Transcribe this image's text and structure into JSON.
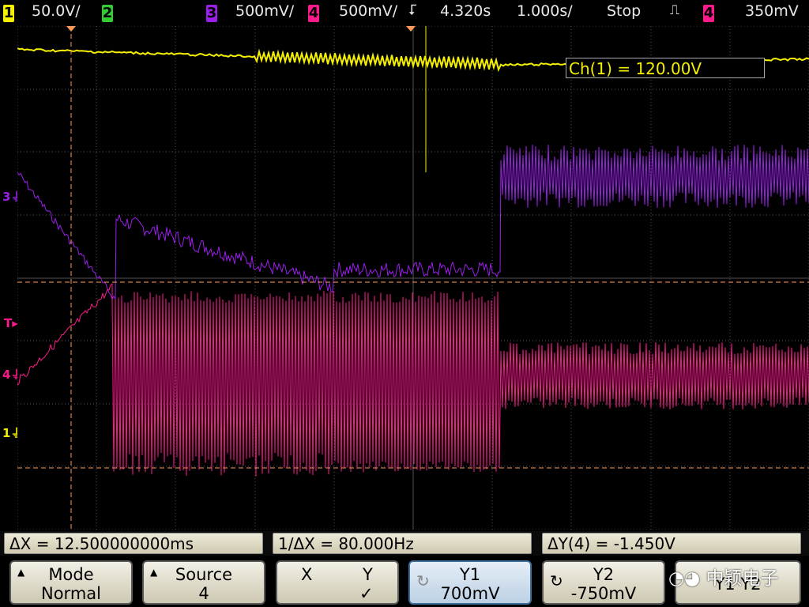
{
  "colors": {
    "ch1": "#f5f000",
    "ch2": "#33cc33",
    "ch3": "#9a1fe8",
    "ch4": "#ff1a8c",
    "grid": "#555555",
    "cursor": "#ff9a5a"
  },
  "topbar": {
    "ch1_num": "1",
    "ch1_scale": "50.0V/",
    "ch2_num": "2",
    "ch3_num": "3",
    "ch3_scale": "500mV/",
    "ch4_num": "4",
    "ch4_scale": "500mV/",
    "trig_delay": "4.320s",
    "timebase": "1.000s/",
    "run_state": "Stop",
    "trig_src": "4",
    "trig_level": "350mV"
  },
  "readout": {
    "ch1": "Ch(1) = 120.00V"
  },
  "markers": {
    "ch3": "3",
    "trig": "T",
    "ch4": "4",
    "ch1": "1"
  },
  "measurements": {
    "delta_x": "ΔX = 12.500000000ms",
    "inv_delta_x": "1/ΔX = 80.000Hz",
    "delta_y": "ΔY(4) = -1.450V"
  },
  "softkeys": {
    "mode": {
      "title": "Mode",
      "value": "Normal"
    },
    "source": {
      "title": "Source",
      "value": "4"
    },
    "xy": {
      "x": "X",
      "y": "Y",
      "check": "✓"
    },
    "y1": {
      "title": "Y1",
      "value": "700mV"
    },
    "y2": {
      "title": "Y2",
      "value": "-750mV"
    },
    "y1y2": {
      "title": "Y1 Y2"
    }
  },
  "watermark": "中颖电子"
}
